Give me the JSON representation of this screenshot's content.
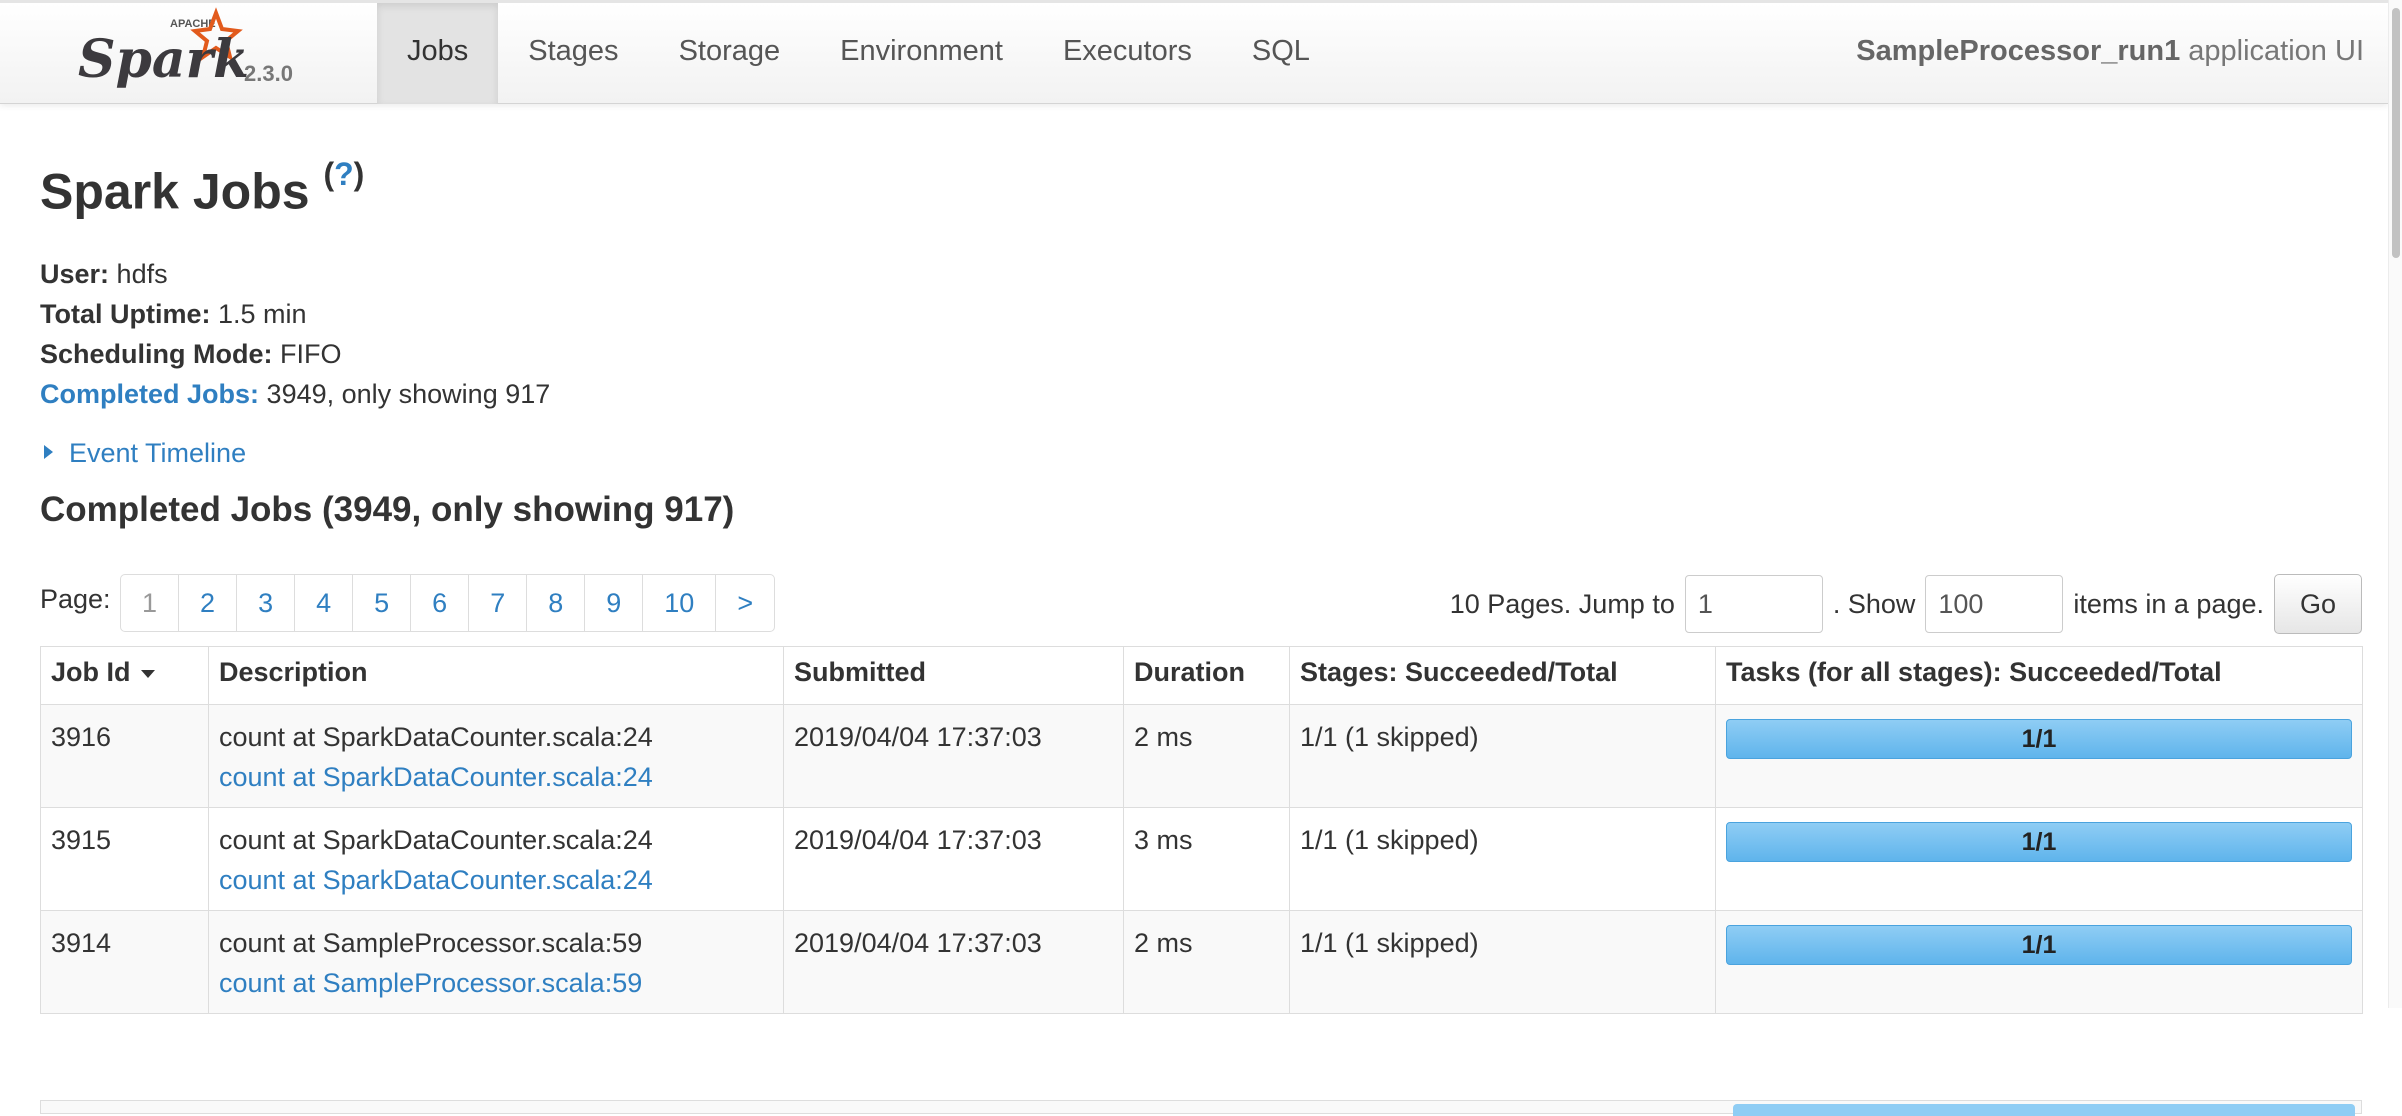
{
  "navbar": {
    "logo_text": "Spark",
    "logo_apache": "APACHE",
    "version": "2.3.0",
    "tabs": [
      {
        "label": "Jobs",
        "active": true
      },
      {
        "label": "Stages",
        "active": false
      },
      {
        "label": "Storage",
        "active": false
      },
      {
        "label": "Environment",
        "active": false
      },
      {
        "label": "Executors",
        "active": false
      },
      {
        "label": "SQL",
        "active": false
      }
    ],
    "app_name": "SampleProcessor_run1",
    "app_suffix": "application UI"
  },
  "page": {
    "title": "Spark Jobs",
    "help_link": "?"
  },
  "summary": {
    "user_label": "User:",
    "user_value": "hdfs",
    "uptime_label": "Total Uptime:",
    "uptime_value": "1.5 min",
    "mode_label": "Scheduling Mode:",
    "mode_value": "FIFO",
    "completed_label": "Completed Jobs:",
    "completed_value": "3949, only showing 917"
  },
  "event_timeline": "Event Timeline",
  "completed_section": {
    "title": "Completed Jobs (3949, only showing 917)"
  },
  "pagination": {
    "page_label": "Page:",
    "pages": [
      "1",
      "2",
      "3",
      "4",
      "5",
      "6",
      "7",
      "8",
      "9",
      "10",
      ">"
    ],
    "pages_text": "10 Pages. Jump to",
    "jump_value": "1",
    "show_text": ". Show",
    "page_size": "100",
    "items_text": "items in a page.",
    "go_label": "Go"
  },
  "table": {
    "headers": {
      "job_id": "Job Id",
      "description": "Description",
      "submitted": "Submitted",
      "duration": "Duration",
      "stages": "Stages: Succeeded/Total",
      "tasks": "Tasks (for all stages): Succeeded/Total"
    },
    "rows": [
      {
        "job_id": "3916",
        "desc": "count at SparkDataCounter.scala:24",
        "desc_link": "count at SparkDataCounter.scala:24",
        "submitted": "2019/04/04 17:37:03",
        "duration": "2 ms",
        "stages": "1/1 (1 skipped)",
        "tasks": "1/1",
        "tasks_fraction": 1.0
      },
      {
        "job_id": "3915",
        "desc": "count at SparkDataCounter.scala:24",
        "desc_link": "count at SparkDataCounter.scala:24",
        "submitted": "2019/04/04 17:37:03",
        "duration": "3 ms",
        "stages": "1/1 (1 skipped)",
        "tasks": "1/1",
        "tasks_fraction": 1.0
      },
      {
        "job_id": "3914",
        "desc": "count at SampleProcessor.scala:59",
        "desc_link": "count at SampleProcessor.scala:59",
        "submitted": "2019/04/04 17:37:03",
        "duration": "2 ms",
        "stages": "1/1 (1 skipped)",
        "tasks": "1/1",
        "tasks_fraction": 1.0
      }
    ]
  },
  "colors": {
    "link": "#2f7fc1",
    "progress": "#5fb4ec",
    "logo_orange": "#e25a1c"
  }
}
